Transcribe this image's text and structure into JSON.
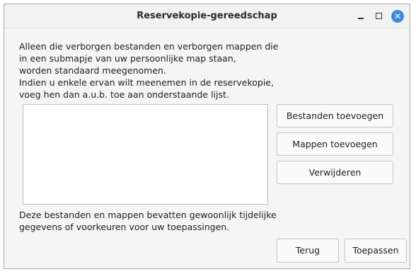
{
  "window": {
    "title": "Reservekopie-gereedschap",
    "close_glyph": "✕"
  },
  "intro": {
    "lines": [
      "Alleen die verborgen bestanden en verborgen mappen die",
      "in een submapje van uw persoonlijke map staan,",
      "worden standaard meegenomen.",
      "Indien u enkele ervan wilt meenemen in de reservekopie,",
      "voeg hen dan a.u.b. toe aan onderstaande lijst."
    ]
  },
  "list": {
    "items": []
  },
  "buttons": {
    "add_files": "Bestanden toevoegen",
    "add_folders": "Mappen toevoegen",
    "remove": "Verwijderen",
    "back": "Terug",
    "apply": "Toepassen"
  },
  "note": {
    "lines": [
      "Deze bestanden en mappen bevatten gewoonlijk tijdelijke",
      "gegevens of voorkeuren voor uw toepassingen."
    ]
  },
  "colors": {
    "close_button": "#3a8ddc",
    "window_bg": "#f5f5f5",
    "list_bg": "#ffffff"
  },
  "icons": {
    "minimize": "minimize-icon",
    "maximize": "maximize-icon",
    "close": "close-icon"
  }
}
